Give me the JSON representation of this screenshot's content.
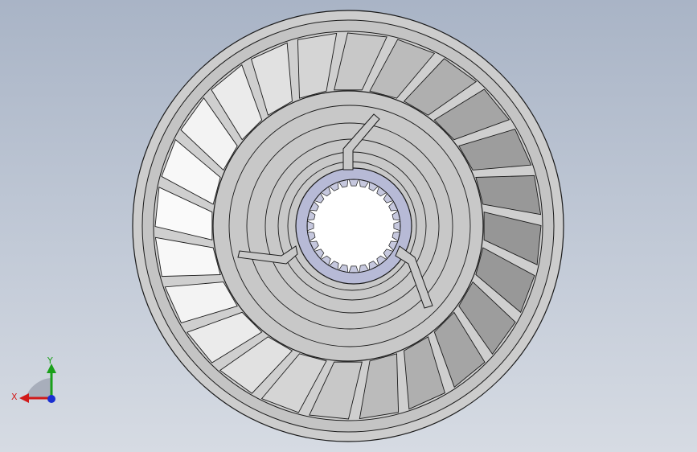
{
  "viewport": {
    "background_top": "#a9b4c6",
    "background_bottom": "#d6dbe3"
  },
  "model": {
    "outer_ring_color": "#c9c9c9",
    "blade_light": "#f2f2f2",
    "blade_dark": "#8f8f8f",
    "hub_color": "#c6c6c6",
    "spline_ring_color": "#b9bcd8",
    "edge_color": "#1a1a1a",
    "blade_count": 24,
    "hub_groove_count": 5,
    "spline_tooth_count": 28
  },
  "triad": {
    "x_label": "X",
    "y_label": "Y",
    "x_color": "#d11a1a",
    "y_color": "#1aa01a",
    "z_color": "#1a2fd1"
  }
}
